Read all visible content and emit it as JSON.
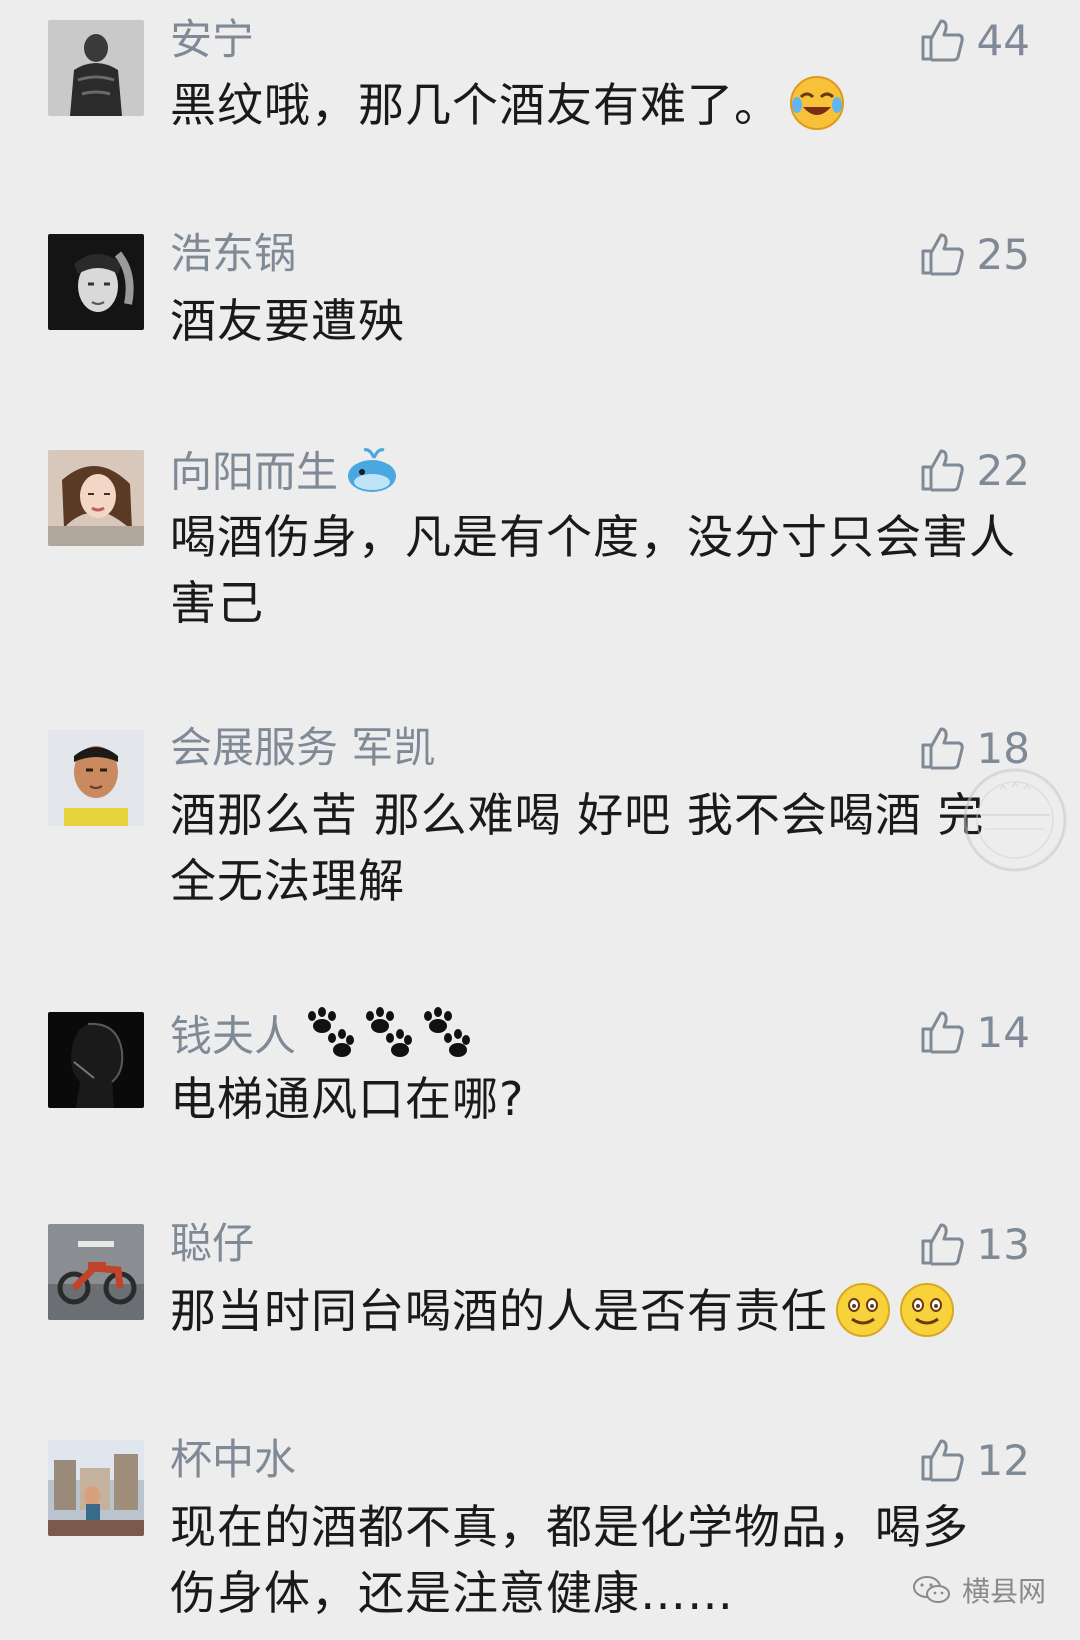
{
  "comments": [
    {
      "name": "安宁",
      "text": "黑纹哦，那几个酒友有难了。",
      "likes": "44",
      "name_emoji": "",
      "text_emoji": "laugh-cry-emoji"
    },
    {
      "name": "浩东锅",
      "text": "酒友要遭殃",
      "likes": "25",
      "name_emoji": "",
      "text_emoji": ""
    },
    {
      "name": "向阳而生",
      "text": "喝酒伤身，凡是有个度，没分寸只会害人害己",
      "likes": "22",
      "name_emoji": "whale-emoji",
      "text_emoji": ""
    },
    {
      "name": "会展服务 军凯",
      "text": "酒那么苦 那么难喝 好吧 我不会喝酒 完全无法理解",
      "likes": "18",
      "name_emoji": "",
      "text_emoji": ""
    },
    {
      "name": "钱夫人",
      "text": "电梯通风口在哪?",
      "likes": "14",
      "name_emoji": "paw-prints-emoji",
      "text_emoji": ""
    },
    {
      "name": "聪仔",
      "text": "那当时同台喝酒的人是否有责任",
      "likes": "13",
      "name_emoji": "",
      "text_emoji": "smile-emoji-x2"
    },
    {
      "name": "杯中水",
      "text": "现在的酒都不真，都是化学物品，喝多伤身体，还是注意健康……",
      "likes": "12",
      "name_emoji": "",
      "text_emoji": ""
    }
  ],
  "watermark": {
    "footer_text": "横县网",
    "stamp_text": "横县网"
  },
  "colors": {
    "background": "#ededed",
    "name": "#7f8a96",
    "text": "#1a1a1a"
  }
}
